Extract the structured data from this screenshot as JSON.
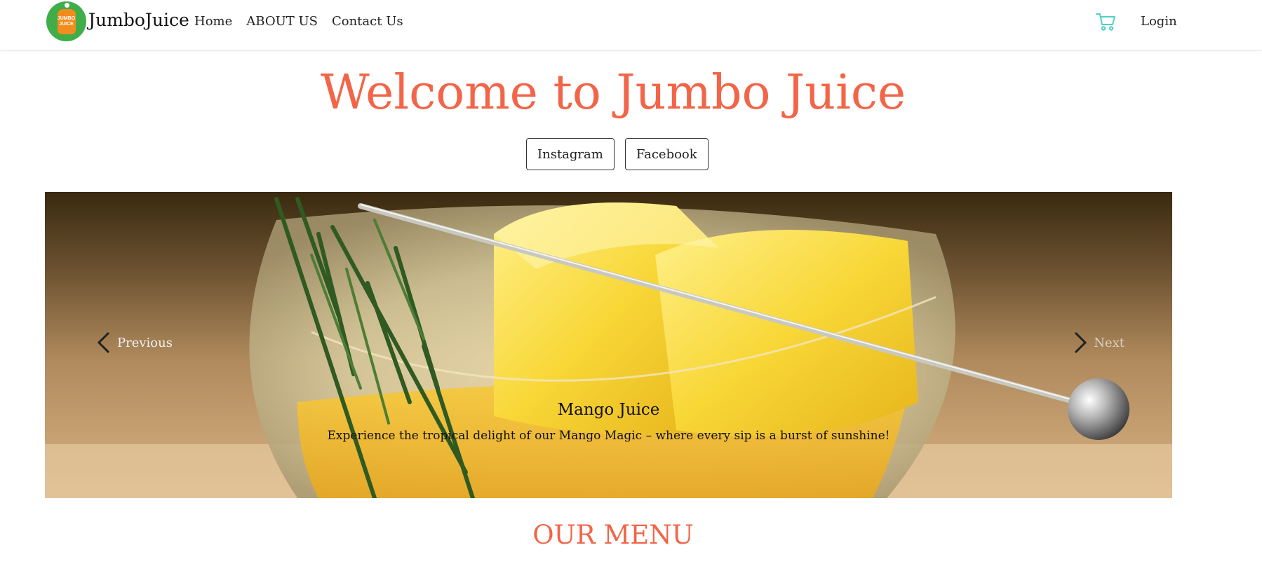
{
  "brand": {
    "name": "JumboJuice",
    "logo_text": [
      "JUMBO",
      "JUICE"
    ]
  },
  "nav": {
    "links": [
      "Home",
      "ABOUT US",
      "Contact Us"
    ],
    "cart_icon": "shopping-cart-icon",
    "login": "Login"
  },
  "hero": {
    "title": "Welcome to Jumbo Juice",
    "social": [
      "Instagram",
      "Facebook"
    ]
  },
  "carousel": {
    "prev": "Previous",
    "next": "Next",
    "slide": {
      "title": "Mango Juice",
      "text": "Experience the tropical delight of our Mango Magic – where every sip is a burst of sunshine!"
    }
  },
  "menu": {
    "heading": "OUR MENU"
  },
  "colors": {
    "accent": "#f26548",
    "cart": "#4fd1c5",
    "logo_green": "#3fae49",
    "logo_orange": "#f28c1e"
  }
}
